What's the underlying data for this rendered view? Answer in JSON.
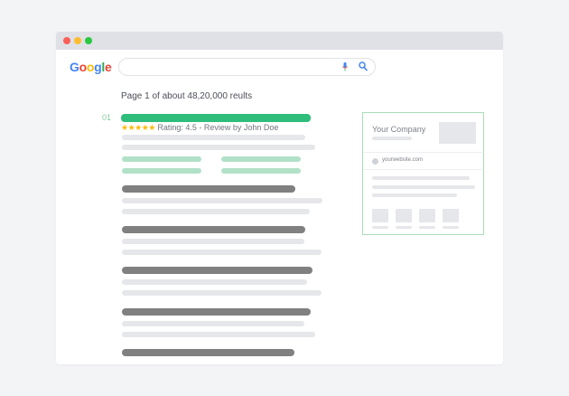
{
  "window": {
    "controls": [
      "close",
      "minimize",
      "maximize"
    ]
  },
  "search": {
    "logo_letters": [
      {
        "char": "G",
        "color": "#4285f4"
      },
      {
        "char": "o",
        "color": "#ea4335"
      },
      {
        "char": "o",
        "color": "#fbbc05"
      },
      {
        "char": "g",
        "color": "#4285f4"
      },
      {
        "char": "l",
        "color": "#34a853"
      },
      {
        "char": "e",
        "color": "#ea4335"
      }
    ],
    "query": "",
    "mic_icon": "microphone-icon",
    "search_icon": "magnifier-icon"
  },
  "results": {
    "count_text": "Page 1 of about 48,20,000 reults",
    "first_rank": "01",
    "stars": "★★★★★",
    "rating_text": "Rating: 4.5 - Review by John Doe"
  },
  "knowledge_panel": {
    "title": "Your Company",
    "url": "yourwebsite.com"
  },
  "colors": {
    "accent_green": "#2fbd7b",
    "light_green": "#b1e1c8",
    "panel_border": "#a9dcb8",
    "dark_bar": "#808080",
    "light_bar": "#e6e7ea"
  }
}
